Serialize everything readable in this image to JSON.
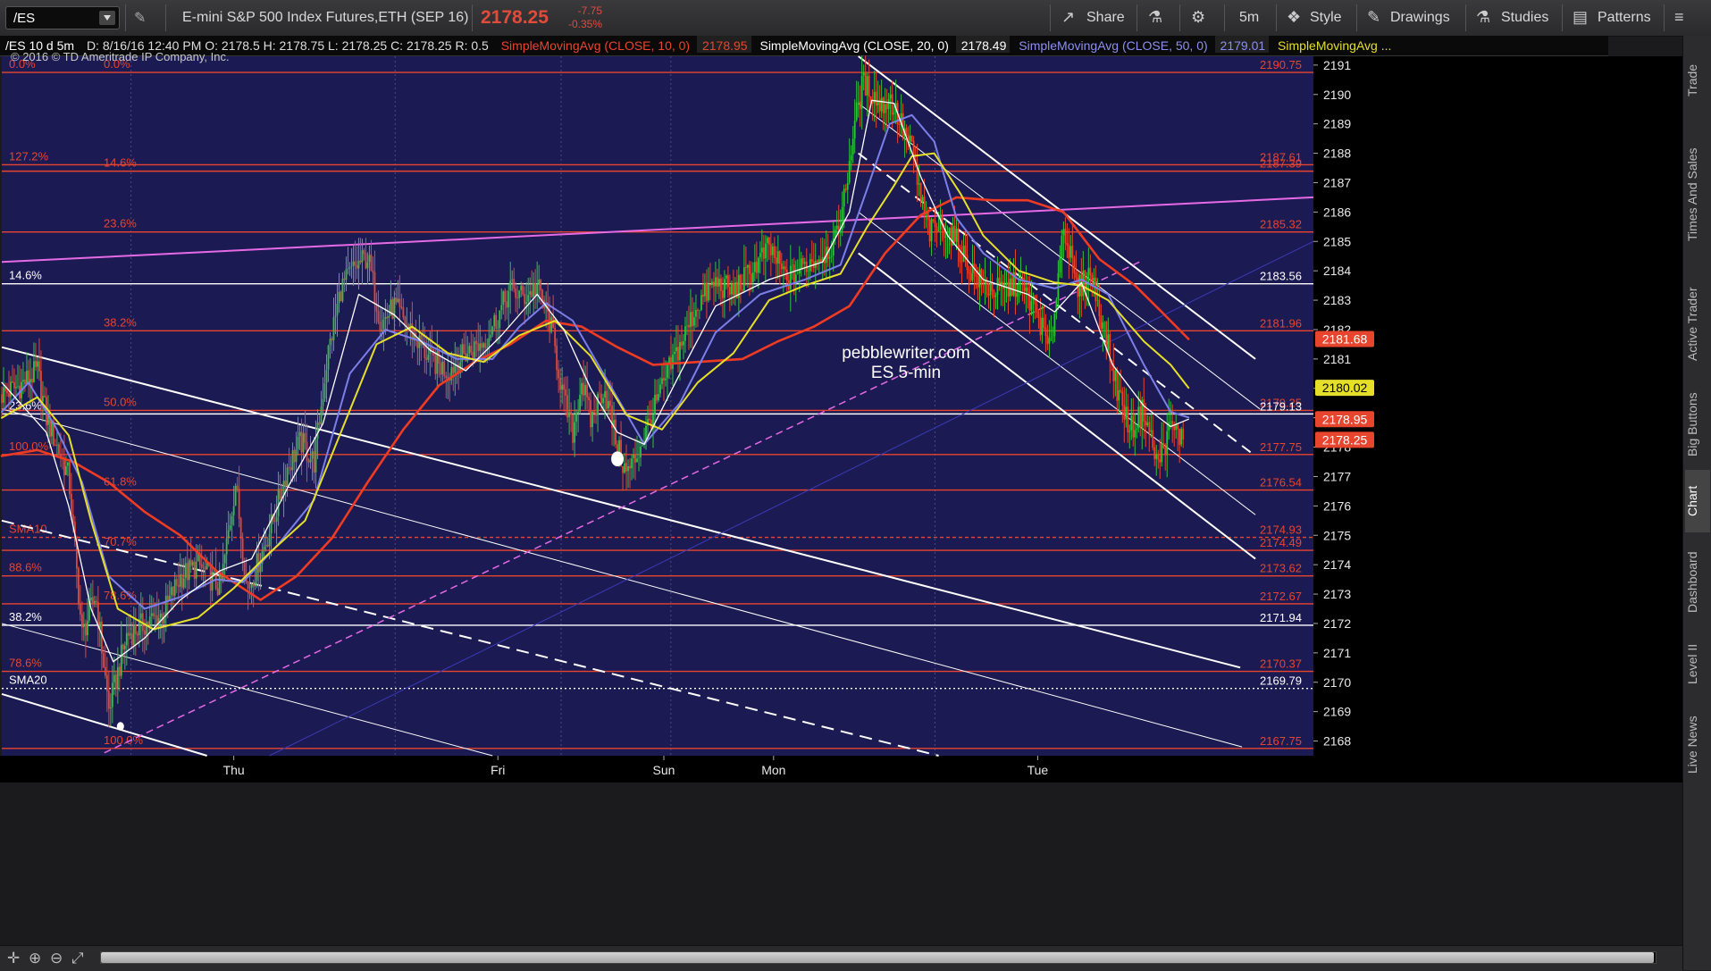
{
  "toolbar": {
    "symbol": "/ES",
    "instrument": "E-mini S&P 500 Index Futures,ETH (SEP 16)",
    "last": "2178.25",
    "net_change": "-7.75",
    "pct_change": "-0.35%",
    "share": "Share",
    "timeframe": "5m",
    "style": "Style",
    "drawings": "Drawings",
    "studies": "Studies",
    "patterns": "Patterns"
  },
  "study_row": {
    "period": "/ES 10 d 5m",
    "ohlc": "D: 8/16/16 12:40 PM  O: 2178.5  H: 2178.75  L: 2178.25  C: 2178.25  R: 0.5",
    "sma10_label": "SimpleMovingAvg (CLOSE, 10, 0)",
    "sma10_value": "2178.95",
    "sma20_label": "SimpleMovingAvg (CLOSE, 20, 0)",
    "sma20_value": "2178.49",
    "sma50_label": "SimpleMovingAvg (CLOSE, 50, 0)",
    "sma50_value": "2179.01",
    "sma_more": "SimpleMovingAvg ..."
  },
  "side_tabs": [
    "Trade",
    "Times And Sales",
    "Active Trader",
    "Big Buttons",
    "Chart",
    "Dashboard",
    "Level II",
    "Live News"
  ],
  "colors": {
    "chart_bg": "#1c1a52",
    "fib_red": "#e8452f",
    "sma10": "#ffffff",
    "sma20": "#e6df2a",
    "sma50": "#7b7fe8",
    "sma200": "#ef3b22",
    "magenta": "#e66ae6"
  },
  "chart_data": {
    "type": "line",
    "symbol": "/ES",
    "copyright": "© 2016 © TD Ameritrade IP Company, Inc.",
    "watermark_line1": "pebblewriter.com",
    "watermark_line2": "ES 5-min",
    "ylim": [
      2167.5,
      2191.3
    ],
    "y_ticks": [
      2168,
      2169,
      2170,
      2171,
      2172,
      2173,
      2174,
      2175,
      2176,
      2177,
      2178,
      2179,
      2180,
      2181,
      2182,
      2183,
      2184,
      2185,
      2186,
      2187,
      2188,
      2189,
      2190,
      2191
    ],
    "x_day_labels": [
      {
        "label": "Thu",
        "t": 260
      },
      {
        "label": "Fri",
        "t": 556
      },
      {
        "label": "Sun",
        "t": 742
      },
      {
        "label": "Mon",
        "t": 865
      },
      {
        "label": "Tue",
        "t": 1161
      }
    ],
    "x_range": [
      0,
      1470
    ],
    "fib_levels": [
      {
        "y": 2190.75,
        "left": "0.0%",
        "right": "2190.75",
        "style": "solid",
        "color": "#e8452f",
        "labelx": 2,
        "center": "0.0%"
      },
      {
        "y": 2187.61,
        "left": "127.2%",
        "right": "2187.61",
        "style": "solid",
        "color": "#e8452f"
      },
      {
        "y": 2187.39,
        "center": "14.6%",
        "right": "2187.39",
        "style": "solid",
        "color": "#e8452f"
      },
      {
        "y": 2185.32,
        "center": "23.6%",
        "right": "2185.32",
        "style": "solid",
        "color": "#e8452f"
      },
      {
        "y": 2183.56,
        "left": "14.6%",
        "right": "2183.56",
        "style": "solid",
        "color": "#ffffff"
      },
      {
        "y": 2181.96,
        "center": "38.2%",
        "right": "2181.96",
        "style": "solid",
        "color": "#e8452f"
      },
      {
        "y": 2179.25,
        "center": "50.0%",
        "right": "2179.25",
        "style": "solid",
        "color": "#e8452f"
      },
      {
        "y": 2179.13,
        "left": "23.6%",
        "right": "2179.13",
        "style": "solid",
        "color": "#ffffff"
      },
      {
        "y": 2177.75,
        "left": "100.0%",
        "right": "2177.75",
        "style": "solid",
        "color": "#e8452f"
      },
      {
        "y": 2176.54,
        "center": "61.8%",
        "right": "2176.54",
        "style": "solid",
        "color": "#e8452f"
      },
      {
        "y": 2174.93,
        "left": "SMA10",
        "right": "2174.93",
        "style": "dashed",
        "color": "#e8452f"
      },
      {
        "y": 2174.49,
        "center": "70.7%",
        "right": "2174.49",
        "style": "solid",
        "color": "#e8452f"
      },
      {
        "y": 2173.62,
        "left": "88.6%",
        "right": "2173.62",
        "style": "solid",
        "color": "#e8452f"
      },
      {
        "y": 2172.67,
        "center": "78.6%",
        "right": "2172.67",
        "style": "solid",
        "color": "#e8452f"
      },
      {
        "y": 2171.94,
        "left": "38.2%",
        "right": "2171.94",
        "style": "solid",
        "color": "#ffffff"
      },
      {
        "y": 2170.37,
        "left": "78.6%",
        "right": "2170.37",
        "style": "solid",
        "color": "#e8452f"
      },
      {
        "y": 2169.79,
        "left": "SMA20",
        "right": "2169.79",
        "style": "dotted",
        "color": "#ffffff"
      },
      {
        "y": 2167.75,
        "center": "100.0%",
        "right": "2167.75",
        "style": "solid",
        "color": "#e8452f"
      }
    ],
    "price_tags": [
      {
        "y": 2181.68,
        "text": "2181.68",
        "bg": "#e8452f",
        "fg": "#ffffff"
      },
      {
        "y": 2180.02,
        "text": "2180.02",
        "bg": "#e6df2a",
        "fg": "#000000"
      },
      {
        "y": 2178.95,
        "text": "2178.95",
        "bg": "#e8452f",
        "fg": "#ffffff"
      },
      {
        "y": 2178.25,
        "text": "2178.25",
        "bg": "#e8452f",
        "fg": "#ffffff"
      }
    ],
    "trendlines": [
      {
        "p1": [
          0,
          2181.4
        ],
        "p2": [
          1388,
          2170.5
        ],
        "color": "#ffffff",
        "width": 2,
        "dash": ""
      },
      {
        "p1": [
          0,
          2179.3
        ],
        "p2": [
          1390,
          2167.8
        ],
        "color": "#ffffff",
        "width": 1,
        "dash": ""
      },
      {
        "p1": [
          0,
          2175.5
        ],
        "p2": [
          1050,
          2167.5
        ],
        "color": "#ffffff",
        "width": 2,
        "dash": "14,8"
      },
      {
        "p1": [
          0,
          2172.0
        ],
        "p2": [
          550,
          2167.5
        ],
        "color": "#ffffff",
        "width": 1,
        "dash": ""
      },
      {
        "p1": [
          0,
          2169.6
        ],
        "p2": [
          230,
          2167.5
        ],
        "color": "#ffffff",
        "width": 2,
        "dash": ""
      },
      {
        "p1": [
          960,
          2191.3
        ],
        "p2": [
          1405,
          2181.0
        ],
        "color": "#ffffff",
        "width": 2,
        "dash": ""
      },
      {
        "p1": [
          960,
          2189.7
        ],
        "p2": [
          1410,
          2179.3
        ],
        "color": "#ffffff",
        "width": 1,
        "dash": ""
      },
      {
        "p1": [
          960,
          2188.0
        ],
        "p2": [
          1405,
          2177.7
        ],
        "color": "#ffffff",
        "width": 2,
        "dash": "12,8"
      },
      {
        "p1": [
          960,
          2186.0
        ],
        "p2": [
          1405,
          2175.7
        ],
        "color": "#ffffff",
        "width": 1,
        "dash": ""
      },
      {
        "p1": [
          960,
          2184.6
        ],
        "p2": [
          1405,
          2174.2
        ],
        "color": "#ffffff",
        "width": 2,
        "dash": ""
      },
      {
        "p1": [
          0,
          2184.3
        ],
        "p2": [
          1470,
          2186.5
        ],
        "color": "#e66ae6",
        "width": 2,
        "dash": ""
      },
      {
        "p1": [
          115,
          2167.6
        ],
        "p2": [
          1275,
          2184.3
        ],
        "color": "#e66ae6",
        "width": 1.5,
        "dash": "8,5"
      },
      {
        "p1": [
          300,
          2167.5
        ],
        "p2": [
          1470,
          2185.0
        ],
        "color": "#3a3ab8",
        "width": 1,
        "dash": ""
      }
    ],
    "markers": [
      {
        "t": 690,
        "y": 2177.6,
        "r": 7
      },
      {
        "t": 133,
        "y": 2168.5,
        "r": 4
      }
    ],
    "anchor_times": [
      0,
      20,
      40,
      50,
      60,
      75,
      90,
      105,
      120,
      140,
      160,
      180,
      200,
      220,
      245,
      262,
      275,
      290,
      305,
      320,
      335,
      350,
      365,
      380,
      395,
      410,
      425,
      440,
      460,
      480,
      500,
      520,
      540,
      555,
      570,
      585,
      600,
      615,
      630,
      640,
      650,
      660,
      675,
      690,
      700,
      710,
      720,
      735,
      750,
      765,
      780,
      800,
      820,
      840,
      860,
      880,
      900,
      920,
      935,
      945,
      955,
      965,
      975,
      985,
      995,
      1005,
      1020,
      1030,
      1040,
      1055,
      1070,
      1085,
      1100,
      1120,
      1140,
      1160,
      1175,
      1190,
      1205,
      1220,
      1235,
      1250,
      1265,
      1280,
      1295,
      1310,
      1325
    ],
    "anchor_prices": [
      2179.8,
      2180.1,
      2180.6,
      2179.0,
      2178.2,
      2177.0,
      2171.6,
      2173.0,
      2169.1,
      2171.6,
      2172.0,
      2172.3,
      2173.6,
      2174.0,
      2173.2,
      2176.8,
      2173.1,
      2174.3,
      2175.6,
      2177.3,
      2178.2,
      2177.5,
      2181.1,
      2183.4,
      2184.1,
      2184.5,
      2182.2,
      2182.8,
      2181.9,
      2181.0,
      2180.6,
      2181.2,
      2181.6,
      2182.4,
      2183.4,
      2183.1,
      2183.5,
      2182.2,
      2179.6,
      2178.5,
      2180.3,
      2178.9,
      2180.1,
      2178.0,
      2177.1,
      2177.6,
      2178.4,
      2179.6,
      2180.8,
      2181.8,
      2182.9,
      2183.6,
      2183.3,
      2184.0,
      2184.8,
      2183.7,
      2184.2,
      2184.6,
      2185.0,
      2186.6,
      2188.9,
      2190.4,
      2190.1,
      2189.6,
      2189.9,
      2189.2,
      2188.1,
      2186.4,
      2185.3,
      2185.6,
      2185.0,
      2184.1,
      2183.5,
      2183.3,
      2183.6,
      2182.6,
      2181.2,
      2185.7,
      2183.3,
      2184.0,
      2182.1,
      2180.0,
      2178.6,
      2179.3,
      2177.4,
      2178.7,
      2178.25
    ],
    "sma10_anchors": [
      [
        0,
        2180.2
      ],
      [
        50,
        2178.5
      ],
      [
        75,
        2176.0
      ],
      [
        100,
        2172.5
      ],
      [
        125,
        2170.7
      ],
      [
        160,
        2171.5
      ],
      [
        200,
        2172.8
      ],
      [
        245,
        2173.8
      ],
      [
        280,
        2174.2
      ],
      [
        320,
        2176.6
      ],
      [
        360,
        2178.8
      ],
      [
        400,
        2183.2
      ],
      [
        440,
        2182.5
      ],
      [
        480,
        2181.3
      ],
      [
        520,
        2180.6
      ],
      [
        560,
        2181.8
      ],
      [
        600,
        2183.2
      ],
      [
        630,
        2182.0
      ],
      [
        660,
        2180.0
      ],
      [
        690,
        2178.5
      ],
      [
        720,
        2178.1
      ],
      [
        760,
        2180.5
      ],
      [
        800,
        2182.8
      ],
      [
        860,
        2183.7
      ],
      [
        920,
        2184.3
      ],
      [
        950,
        2186.0
      ],
      [
        975,
        2189.8
      ],
      [
        1000,
        2189.7
      ],
      [
        1030,
        2187.2
      ],
      [
        1060,
        2185.2
      ],
      [
        1100,
        2183.7
      ],
      [
        1150,
        2183.2
      ],
      [
        1180,
        2182.6
      ],
      [
        1210,
        2183.6
      ],
      [
        1245,
        2180.8
      ],
      [
        1280,
        2179.4
      ],
      [
        1310,
        2178.7
      ],
      [
        1330,
        2178.95
      ]
    ],
    "sma20_anchors": [
      [
        0,
        2179.0
      ],
      [
        40,
        2179.7
      ],
      [
        75,
        2178.4
      ],
      [
        100,
        2175.5
      ],
      [
        130,
        2172.5
      ],
      [
        170,
        2171.8
      ],
      [
        220,
        2172.2
      ],
      [
        260,
        2173.2
      ],
      [
        300,
        2174.4
      ],
      [
        340,
        2175.5
      ],
      [
        380,
        2178.5
      ],
      [
        420,
        2181.5
      ],
      [
        460,
        2182.1
      ],
      [
        500,
        2181.2
      ],
      [
        540,
        2180.9
      ],
      [
        580,
        2181.8
      ],
      [
        620,
        2182.3
      ],
      [
        660,
        2181.1
      ],
      [
        700,
        2179.1
      ],
      [
        740,
        2178.6
      ],
      [
        780,
        2180.2
      ],
      [
        820,
        2181.2
      ],
      [
        860,
        2183.0
      ],
      [
        900,
        2183.5
      ],
      [
        940,
        2183.9
      ],
      [
        970,
        2185.5
      ],
      [
        1000,
        2186.9
      ],
      [
        1020,
        2187.9
      ],
      [
        1045,
        2188.0
      ],
      [
        1075,
        2186.6
      ],
      [
        1100,
        2185.2
      ],
      [
        1140,
        2184.0
      ],
      [
        1180,
        2183.6
      ],
      [
        1210,
        2183.5
      ],
      [
        1240,
        2183.0
      ],
      [
        1280,
        2181.6
      ],
      [
        1310,
        2180.8
      ],
      [
        1330,
        2180.02
      ]
    ],
    "sma50_anchors": [
      [
        0,
        2179.2
      ],
      [
        30,
        2180.2
      ],
      [
        60,
        2178.7
      ],
      [
        90,
        2176.8
      ],
      [
        120,
        2173.6
      ],
      [
        160,
        2172.5
      ],
      [
        200,
        2172.9
      ],
      [
        240,
        2173.5
      ],
      [
        270,
        2173.4
      ],
      [
        310,
        2174.7
      ],
      [
        350,
        2176.2
      ],
      [
        390,
        2180.5
      ],
      [
        430,
        2182.0
      ],
      [
        470,
        2181.6
      ],
      [
        510,
        2181.0
      ],
      [
        550,
        2181.0
      ],
      [
        580,
        2182.1
      ],
      [
        610,
        2182.9
      ],
      [
        640,
        2182.3
      ],
      [
        680,
        2180.2
      ],
      [
        720,
        2178.1
      ],
      [
        760,
        2179.5
      ],
      [
        800,
        2181.9
      ],
      [
        850,
        2183.2
      ],
      [
        900,
        2183.7
      ],
      [
        940,
        2184.2
      ],
      [
        970,
        2186.8
      ],
      [
        995,
        2189.0
      ],
      [
        1020,
        2189.3
      ],
      [
        1045,
        2188.4
      ],
      [
        1070,
        2185.8
      ],
      [
        1100,
        2184.6
      ],
      [
        1140,
        2183.7
      ],
      [
        1180,
        2183.4
      ],
      [
        1210,
        2183.7
      ],
      [
        1240,
        2183.2
      ],
      [
        1280,
        2180.8
      ],
      [
        1310,
        2179.2
      ],
      [
        1330,
        2179.01
      ]
    ],
    "sma200_anchors": [
      [
        0,
        2177.7
      ],
      [
        40,
        2177.9
      ],
      [
        80,
        2177.5
      ],
      [
        120,
        2176.8
      ],
      [
        160,
        2175.8
      ],
      [
        200,
        2175.0
      ],
      [
        240,
        2173.8
      ],
      [
        290,
        2172.8
      ],
      [
        330,
        2173.6
      ],
      [
        370,
        2174.9
      ],
      [
        410,
        2176.8
      ],
      [
        450,
        2178.6
      ],
      [
        490,
        2180.1
      ],
      [
        530,
        2180.9
      ],
      [
        570,
        2181.5
      ],
      [
        610,
        2182.3
      ],
      [
        650,
        2182.1
      ],
      [
        690,
        2181.4
      ],
      [
        730,
        2180.8
      ],
      [
        780,
        2180.9
      ],
      [
        830,
        2181.0
      ],
      [
        870,
        2181.6
      ],
      [
        910,
        2182.1
      ],
      [
        950,
        2182.8
      ],
      [
        990,
        2184.6
      ],
      [
        1030,
        2185.9
      ],
      [
        1070,
        2186.5
      ],
      [
        1110,
        2186.4
      ],
      [
        1150,
        2186.4
      ],
      [
        1190,
        2186.0
      ],
      [
        1230,
        2184.4
      ],
      [
        1270,
        2183.5
      ],
      [
        1300,
        2182.6
      ],
      [
        1330,
        2181.68
      ]
    ]
  }
}
